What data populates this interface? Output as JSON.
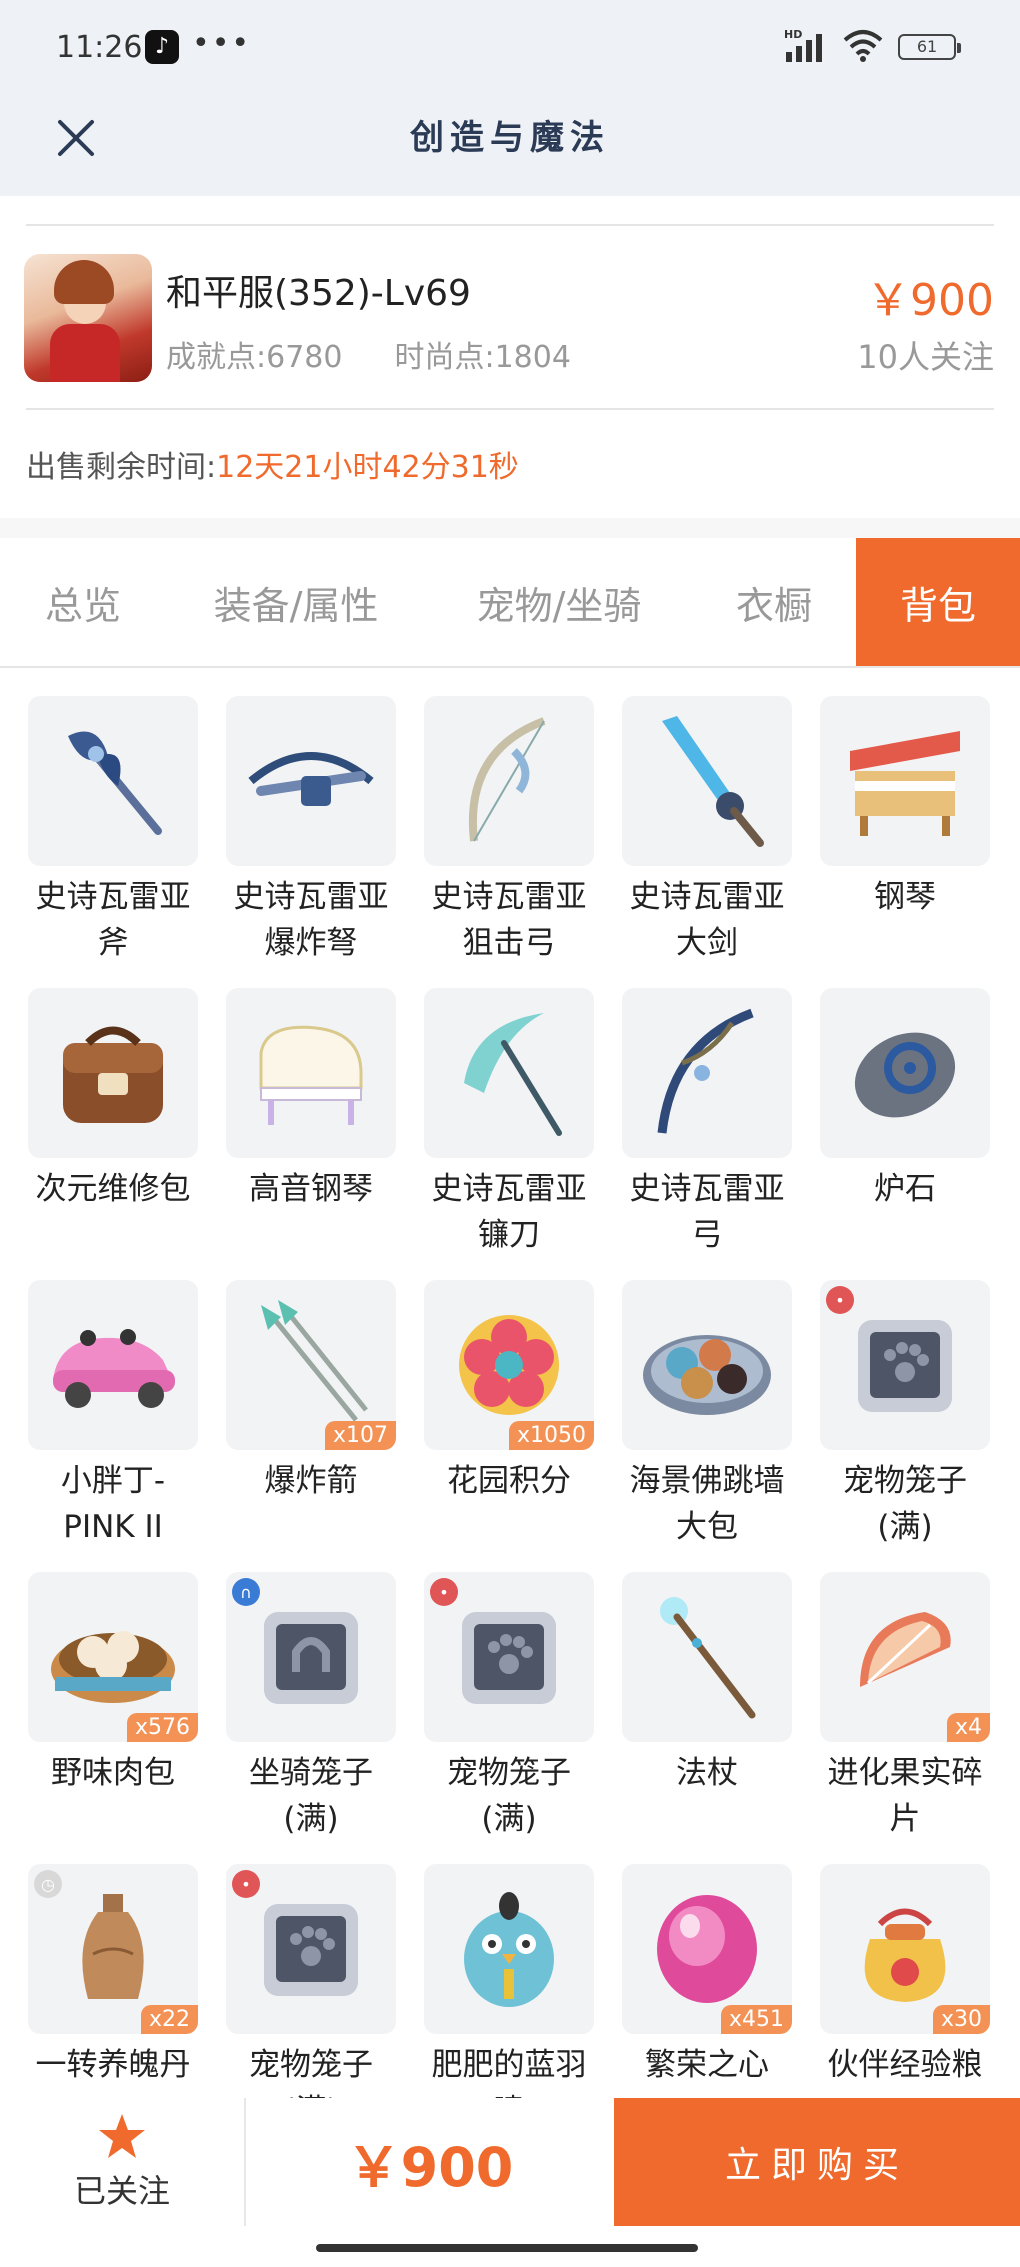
{
  "status_bar": {
    "time": "11:26",
    "app_icon": "tiktok-icon",
    "more": "•••",
    "network": "HD",
    "battery": "61"
  },
  "header": {
    "title": "创造与魔法",
    "close_icon": "close-icon"
  },
  "account": {
    "name": "和平服(352)-Lv69",
    "achievement": "成就点:6780",
    "fashion": "时尚点:1804",
    "price": "￥900",
    "followers": "10人关注",
    "remain_label": "出售剩余时间:",
    "remain_value": "12天21小时42分31秒"
  },
  "tabs": [
    {
      "label": "总览",
      "active": false
    },
    {
      "label": "装备/属性",
      "active": false
    },
    {
      "label": "宠物/坐骑",
      "active": false
    },
    {
      "label": "衣橱",
      "active": false
    },
    {
      "label": "背包",
      "active": true
    }
  ],
  "items": [
    {
      "name": "史诗瓦雷亚\n斧",
      "icon": "axe-icon",
      "count": "",
      "corner": ""
    },
    {
      "name": "史诗瓦雷亚\n爆炸弩",
      "icon": "crossbow-icon",
      "count": "",
      "corner": ""
    },
    {
      "name": "史诗瓦雷亚\n狙击弓",
      "icon": "bow-icon",
      "count": "",
      "corner": ""
    },
    {
      "name": "史诗瓦雷亚\n大剑",
      "icon": "greatsword-icon",
      "count": "",
      "corner": ""
    },
    {
      "name": "钢琴",
      "icon": "piano-icon",
      "count": "",
      "corner": ""
    },
    {
      "name": "次元维修包",
      "icon": "repair-bag-icon",
      "count": "",
      "corner": ""
    },
    {
      "name": "高音钢琴",
      "icon": "grand-piano-icon",
      "count": "",
      "corner": ""
    },
    {
      "name": "史诗瓦雷亚\n镰刀",
      "icon": "scythe-icon",
      "count": "",
      "corner": ""
    },
    {
      "name": "史诗瓦雷亚\n弓",
      "icon": "longbow-icon",
      "count": "",
      "corner": ""
    },
    {
      "name": "炉石",
      "icon": "hearthstone-icon",
      "count": "",
      "corner": ""
    },
    {
      "name": "小胖丁-\nPINK II",
      "icon": "car-icon",
      "count": "",
      "corner": ""
    },
    {
      "name": "爆炸箭",
      "icon": "arrow-icon",
      "count": "x107",
      "corner": ""
    },
    {
      "name": "花园积分",
      "icon": "flower-badge-icon",
      "count": "x1050",
      "corner": ""
    },
    {
      "name": "海景佛跳墙\n大包",
      "icon": "dumpling-plate-icon",
      "count": "",
      "corner": ""
    },
    {
      "name": "宠物笼子\n(满)",
      "icon": "pet-cage-icon",
      "count": "",
      "corner": "paw"
    },
    {
      "name": "野味肉包",
      "icon": "bun-basket-icon",
      "count": "x576",
      "corner": ""
    },
    {
      "name": "坐骑笼子\n(满)",
      "icon": "mount-cage-icon",
      "count": "",
      "corner": "horseshoe"
    },
    {
      "name": "宠物笼子\n(满)",
      "icon": "pet-cage-icon",
      "count": "",
      "corner": "paw"
    },
    {
      "name": "法杖",
      "icon": "staff-icon",
      "count": "",
      "corner": ""
    },
    {
      "name": "进化果实碎\n片",
      "icon": "fruit-shard-icon",
      "count": "x4",
      "corner": ""
    },
    {
      "name": "一转养魄丹",
      "icon": "vase-icon",
      "count": "x22",
      "corner": "clock"
    },
    {
      "name": "宠物笼子\n(满)",
      "icon": "pet-cage-icon",
      "count": "",
      "corner": "paw"
    },
    {
      "name": "肥肥的蓝羽\n啸",
      "icon": "blue-bird-icon",
      "count": "",
      "corner": ""
    },
    {
      "name": "繁荣之心",
      "icon": "pink-gem-icon",
      "count": "x451",
      "corner": ""
    },
    {
      "name": "伙伴经验粮",
      "icon": "food-bag-icon",
      "count": "x30",
      "corner": ""
    }
  ],
  "bottom": {
    "fav_label": "已关注",
    "total": "￥900",
    "buy_label": "立即购买"
  },
  "colors": {
    "accent": "#ef6a2c",
    "header_bg": "#eef2f6",
    "title": "#2b3a55"
  }
}
